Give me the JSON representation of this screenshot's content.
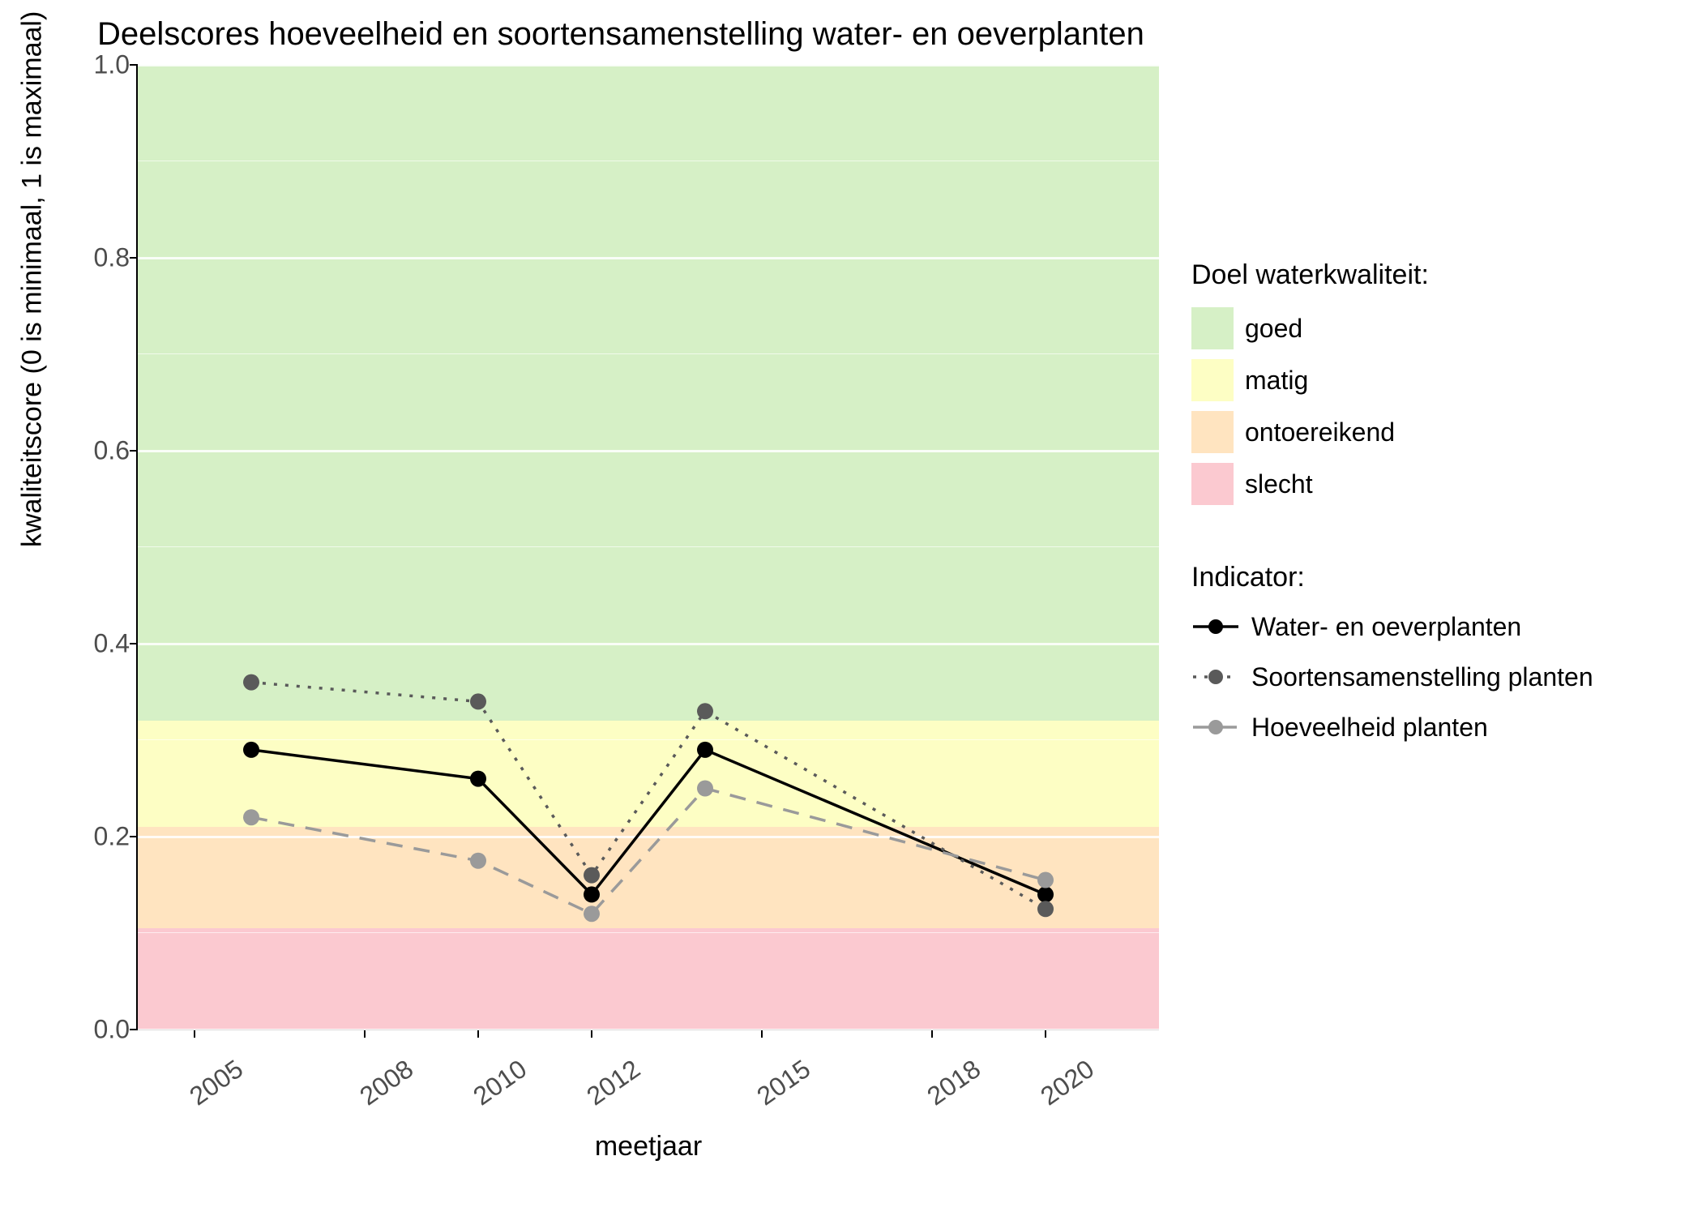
{
  "chart_data": {
    "type": "line",
    "title": "Deelscores hoeveelheid en soortensamenstelling water- en oeverplanten",
    "xlabel": "meetjaar",
    "ylabel": "kwaliteitscore (0 is minimaal, 1 is maximaal)",
    "xlim": [
      2004,
      2022
    ],
    "ylim": [
      0.0,
      1.0
    ],
    "x_ticks": [
      2005,
      2008,
      2010,
      2012,
      2015,
      2018,
      2020
    ],
    "y_ticks": [
      0.0,
      0.2,
      0.4,
      0.6,
      0.8,
      1.0
    ],
    "bands": [
      {
        "name": "goed",
        "from": 0.32,
        "to": 1.0,
        "color": "#d6f0c6"
      },
      {
        "name": "matig",
        "from": 0.21,
        "to": 0.32,
        "color": "#fdfec4"
      },
      {
        "name": "ontoereikend",
        "from": 0.105,
        "to": 0.21,
        "color": "#ffe4c0"
      },
      {
        "name": "slecht",
        "from": 0.0,
        "to": 0.105,
        "color": "#fbc9d0"
      }
    ],
    "series": [
      {
        "name": "Water- en oeverplanten",
        "style": "solid",
        "color": "#000000",
        "point_fill": "#000000",
        "x": [
          2006,
          2010,
          2012,
          2014,
          2020
        ],
        "y": [
          0.29,
          0.26,
          0.14,
          0.29,
          0.14
        ]
      },
      {
        "name": "Soortensamenstelling planten",
        "style": "dotted",
        "color": "#5a5a5a",
        "point_fill": "#5a5a5a",
        "x": [
          2006,
          2010,
          2012,
          2014,
          2020
        ],
        "y": [
          0.36,
          0.34,
          0.16,
          0.33,
          0.125
        ]
      },
      {
        "name": "Hoeveelheid planten",
        "style": "dashed",
        "color": "#9a9a9a",
        "point_fill": "#9a9a9a",
        "x": [
          2006,
          2010,
          2012,
          2014,
          2020
        ],
        "y": [
          0.22,
          0.175,
          0.12,
          0.25,
          0.155
        ]
      }
    ],
    "legends": {
      "band_title": "Doel waterkwaliteit:",
      "band_labels": [
        "goed",
        "matig",
        "ontoereikend",
        "slecht"
      ],
      "series_title": "Indicator:"
    }
  }
}
